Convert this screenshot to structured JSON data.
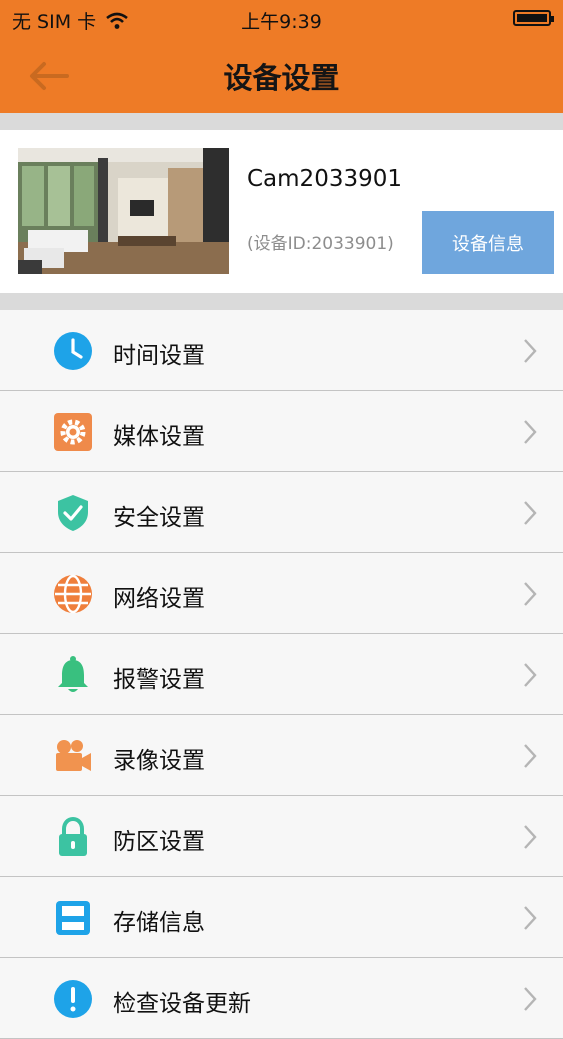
{
  "status_bar": {
    "carrier": "无 SIM 卡",
    "time": "上午9:39"
  },
  "header": {
    "title": "设备设置"
  },
  "device": {
    "name": "Cam2033901",
    "id_text": "(设备ID:2033901)",
    "info_button": "设备信息"
  },
  "menu": [
    {
      "label": "时间设置",
      "icon": "clock-icon",
      "color": "#1ea3e8"
    },
    {
      "label": "媒体设置",
      "icon": "gear-icon",
      "color": "#ef8a4a"
    },
    {
      "label": "安全设置",
      "icon": "shield-check-icon",
      "color": "#3cc3a2"
    },
    {
      "label": "网络设置",
      "icon": "globe-icon",
      "color": "#ef7f3c"
    },
    {
      "label": "报警设置",
      "icon": "bell-icon",
      "color": "#39c07f"
    },
    {
      "label": "录像设置",
      "icon": "video-camera-icon",
      "color": "#f1934f"
    },
    {
      "label": "防区设置",
      "icon": "lock-icon",
      "color": "#3cc3a2"
    },
    {
      "label": "存储信息",
      "icon": "storage-icon",
      "color": "#1ea3e8"
    },
    {
      "label": "检查设备更新",
      "icon": "info-icon",
      "color": "#1ea3e8"
    }
  ],
  "colors": {
    "header": "#ee7b26",
    "info_button": "#6fa6dd",
    "separator": "#dadada"
  }
}
